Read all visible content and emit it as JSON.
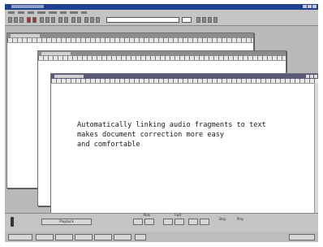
{
  "document": {
    "line1": "Automatically linking audio fragments to text",
    "line2": "makes document correction more easy",
    "line3": "and comfortable"
  },
  "status": {
    "playback_label": "Playback",
    "field_a": "Rew",
    "field_b": "Fwd",
    "field_c": "Stop",
    "field_d": "Play"
  },
  "colors": {
    "titlebar": "#1f3f8f",
    "chrome": "#c4c4c4",
    "desktop": "#b9b9b9"
  }
}
